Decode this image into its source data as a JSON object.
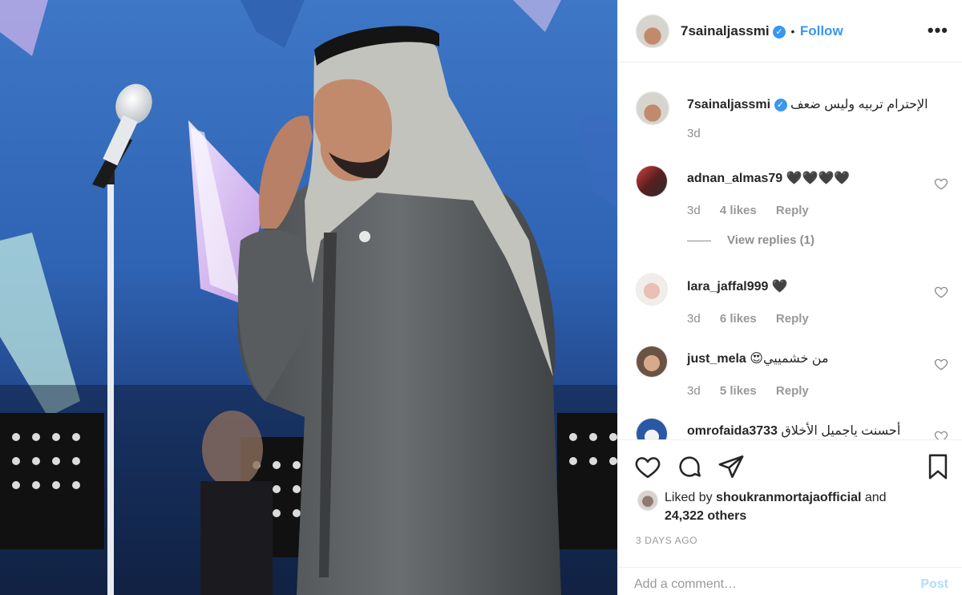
{
  "post": {
    "username": "7sainaljassmi",
    "follow_label": "Follow",
    "follow_separator": "•",
    "more_icon": "more-dots-icon",
    "caption": {
      "username": "7sainaljassmi",
      "text": "الإحترام تربيه وليس ضعف",
      "time": "3d"
    },
    "comments": [
      {
        "username": "adnan_almas79",
        "text": "🖤🖤🖤🖤",
        "time": "3d",
        "likes": "4 likes",
        "reply": "Reply",
        "view_replies": "View replies (1)"
      },
      {
        "username": "lara_jaffal999",
        "text": "🖤",
        "time": "3d",
        "likes": "6 likes",
        "reply": "Reply"
      },
      {
        "username": "just_mela",
        "text": "من خشمييي😍",
        "time": "3d",
        "likes": "5 likes",
        "reply": "Reply"
      },
      {
        "username": "omrofaida3733",
        "text": "أحسنت ياجميل الأخلاق"
      }
    ],
    "liked_by": {
      "prefix": "Liked by",
      "user": "shoukranmortajaofficial",
      "and": "and",
      "others": "24,322 others"
    },
    "date": "3 DAYS AGO",
    "add_comment_placeholder": "Add a comment…",
    "post_label": "Post"
  },
  "colors": {
    "accent": "#3897f0",
    "muted": "#8e8e8e",
    "stage_blue": "#2f63b3"
  }
}
